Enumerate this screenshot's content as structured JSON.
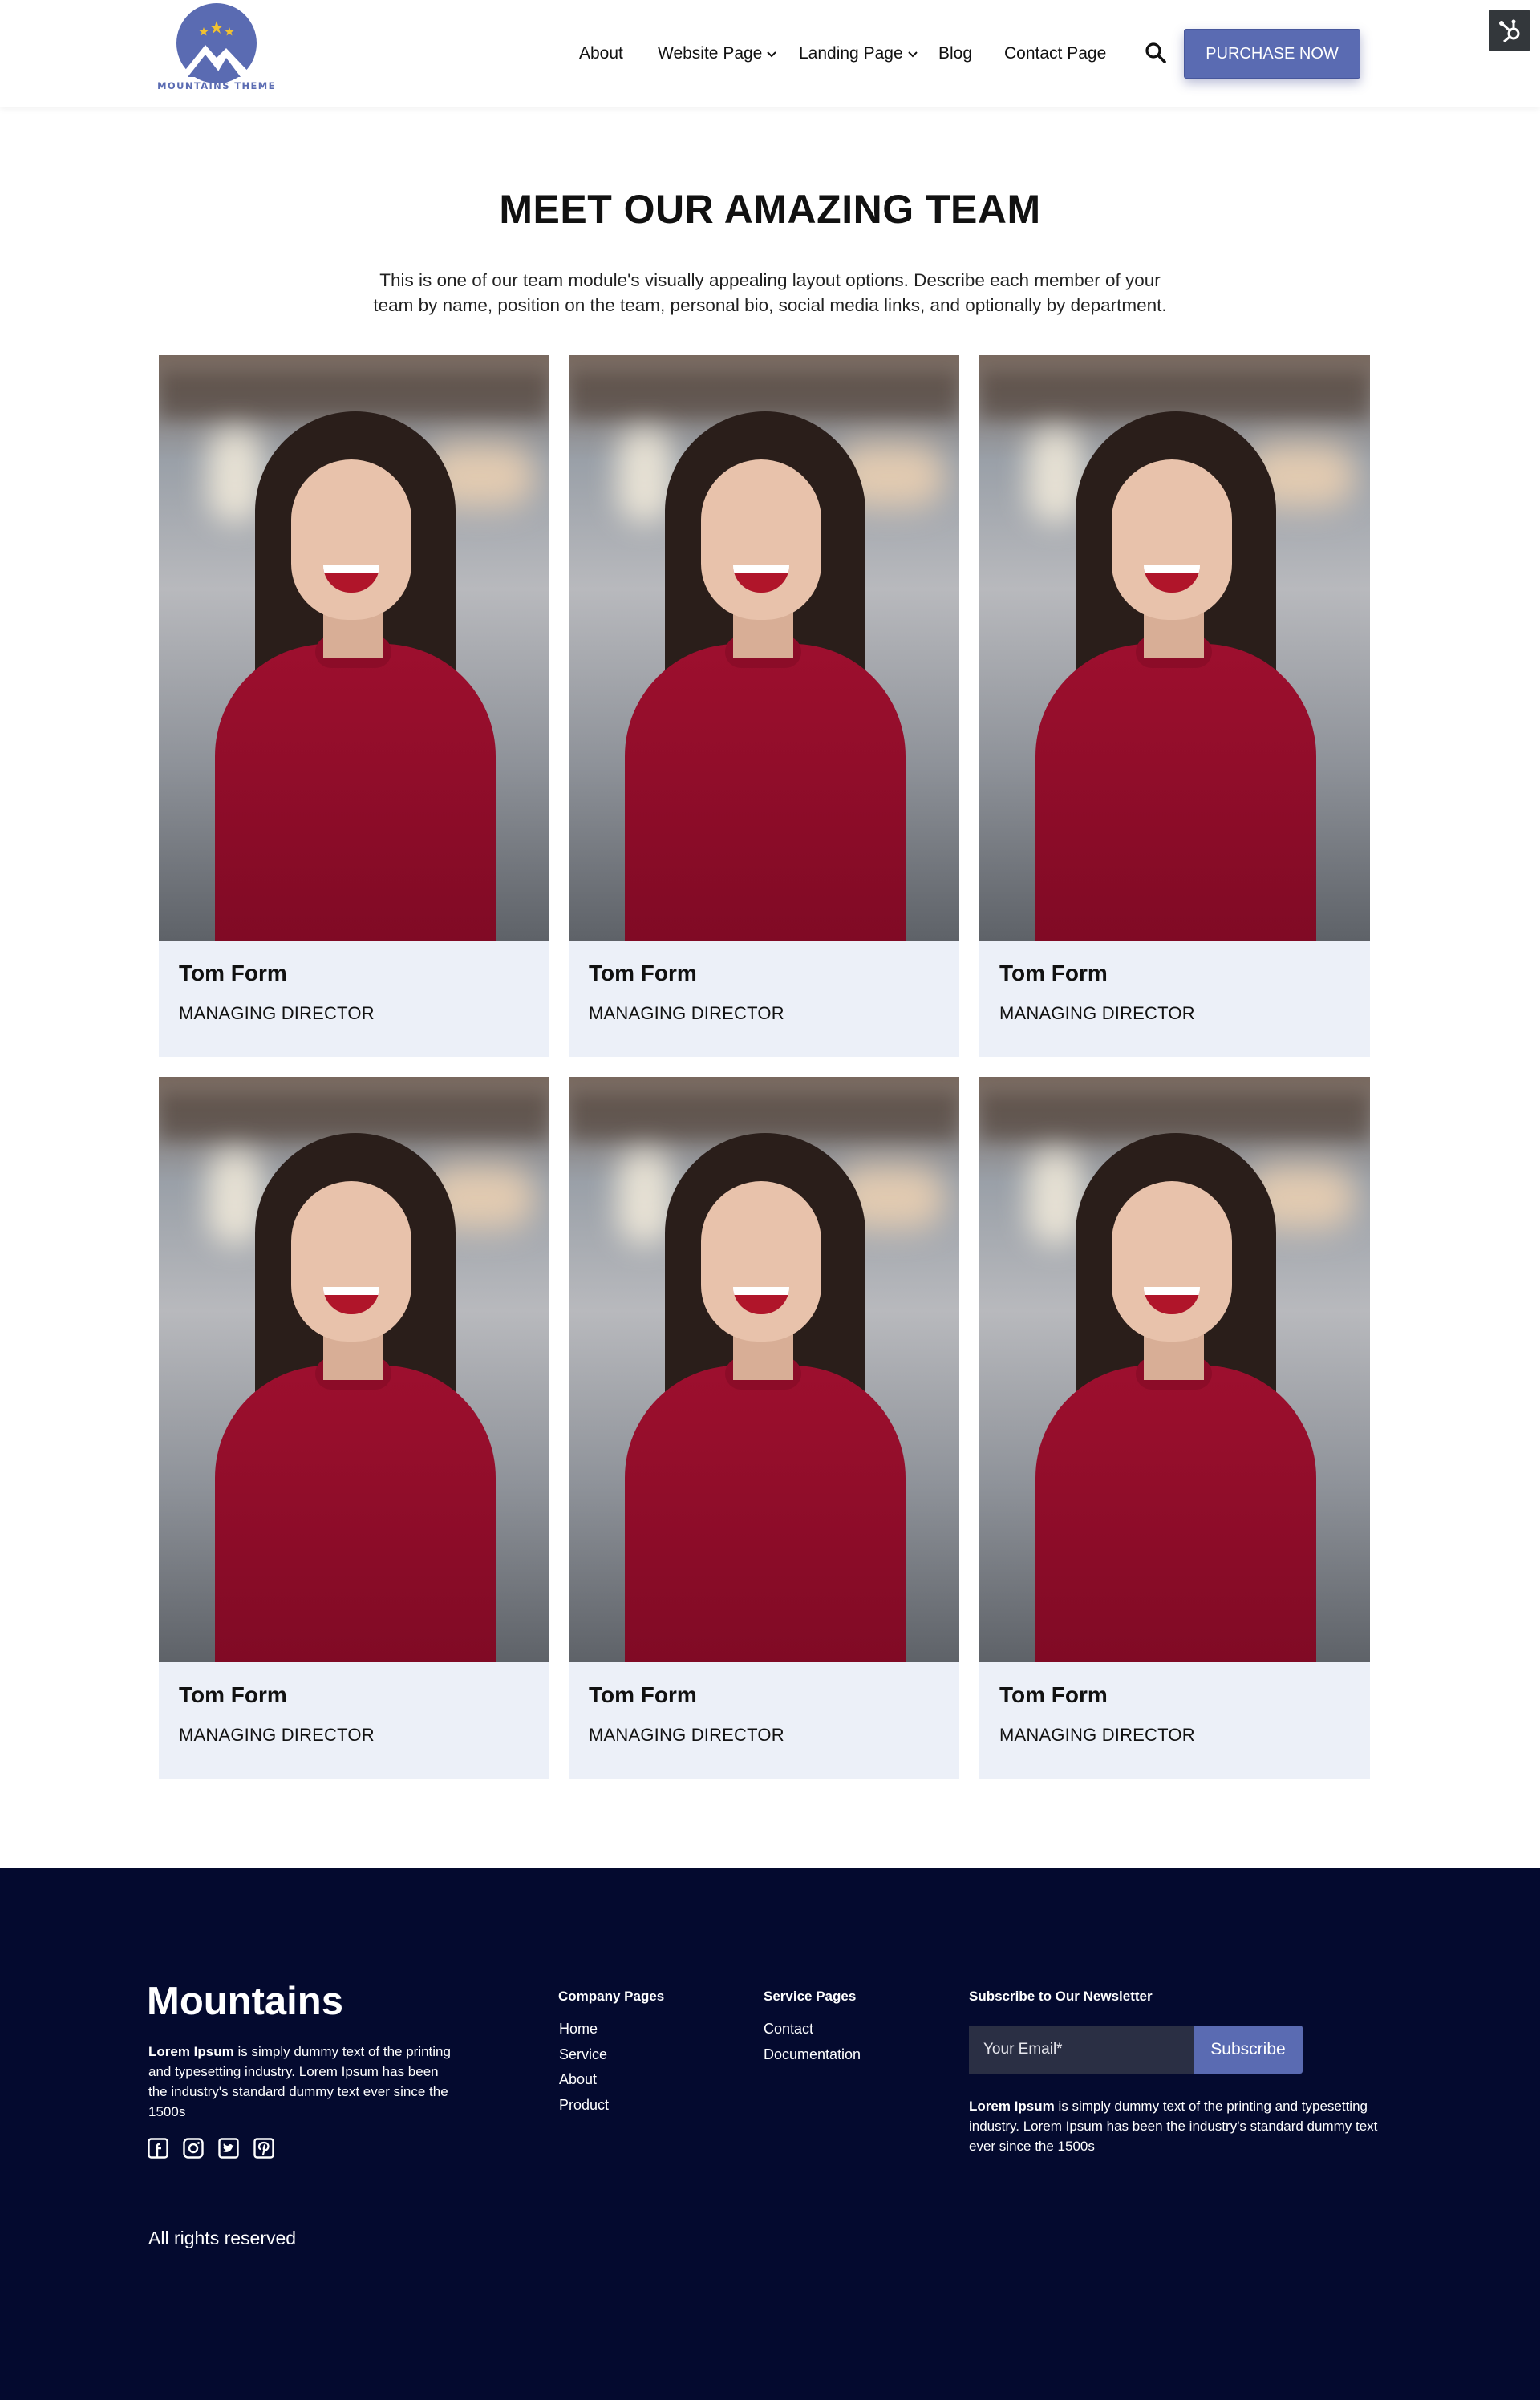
{
  "header": {
    "logo_text": "MOUNTAINS THEME",
    "nav": [
      {
        "label": "About",
        "has_dropdown": false
      },
      {
        "label": "Website Page",
        "has_dropdown": true
      },
      {
        "label": "Landing Page",
        "has_dropdown": true
      },
      {
        "label": "Blog",
        "has_dropdown": false
      },
      {
        "label": "Contact Page",
        "has_dropdown": false
      }
    ],
    "purchase_label": "PURCHASE NOW",
    "icons": {
      "search": "search-icon",
      "hubspot": "hubspot-icon",
      "dropdown": "chevron-down-icon"
    }
  },
  "team": {
    "title": "MEET OUR AMAZING TEAM",
    "intro_line1": "This is one of our team module's visually appealing layout options. Describe each member of your",
    "intro_line2": "team by name, position on the team, personal bio, social media links, and optionally by department.",
    "members": [
      {
        "name": "Tom Form",
        "role": "MANAGING DIRECTOR"
      },
      {
        "name": "Tom Form",
        "role": "MANAGING DIRECTOR"
      },
      {
        "name": "Tom Form",
        "role": "MANAGING DIRECTOR"
      },
      {
        "name": "Tom Form",
        "role": "MANAGING DIRECTOR"
      },
      {
        "name": "Tom Form",
        "role": "MANAGING DIRECTOR"
      },
      {
        "name": "Tom Form",
        "role": "MANAGING DIRECTOR"
      }
    ]
  },
  "footer": {
    "brand": "Mountains",
    "desc_bold": "Lorem Ipsum",
    "desc_rest": " is simply dummy text of the printing and typesetting industry. Lorem Ipsum has been the industry's standard dummy text ever since the 1500s",
    "social": [
      "facebook-icon",
      "instagram-icon",
      "twitter-icon",
      "pinterest-icon"
    ],
    "company_heading": "Company Pages",
    "company_links": [
      "Home",
      "Service",
      "About",
      "Product"
    ],
    "service_heading": "Service Pages",
    "service_links": [
      "Contact",
      "Documentation"
    ],
    "newsletter_heading": "Subscribe to Our Newsletter",
    "email_placeholder": "Your Email*",
    "subscribe_label": "Subscribe",
    "news_desc_bold": "Lorem Ipsum",
    "news_desc_rest": " is simply dummy text of the printing and typesetting industry. Lorem Ipsum has been the industry's standard dummy text ever since the 1500s",
    "rights": "All rights reserved"
  },
  "colors": {
    "accent": "#5a6bb2",
    "footer_bg": "#040a2f",
    "card_bg": "#ecf0f8"
  }
}
